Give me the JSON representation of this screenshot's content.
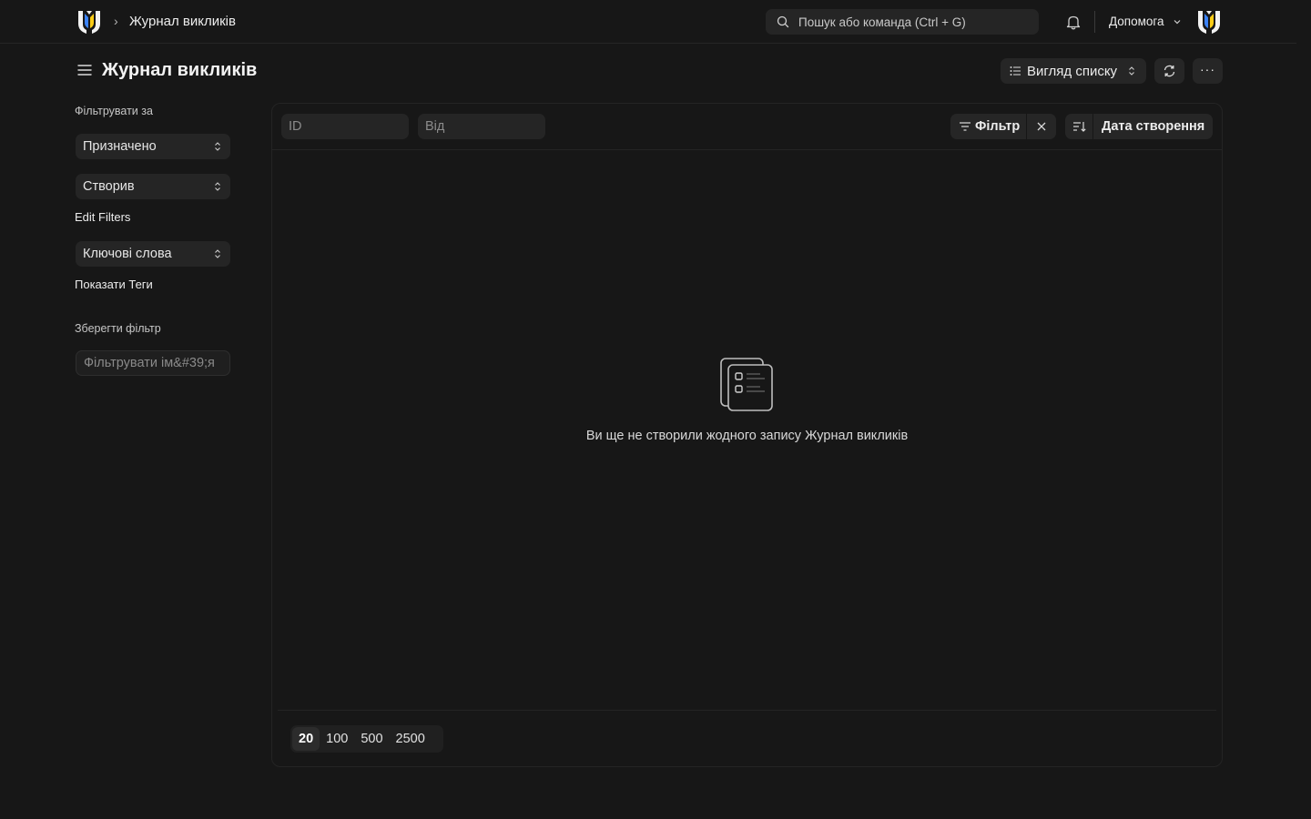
{
  "navbar": {
    "breadcrumb_separator": "›",
    "breadcrumb": "Журнал викликів",
    "search_placeholder": "Пошук або команда (Ctrl + G)",
    "help_label": "Допомога",
    "icons": [
      "app-logo-icon",
      "search-icon",
      "bell-icon",
      "chevron-down-icon",
      "avatar-logo-icon"
    ]
  },
  "page": {
    "title": "Журнал викликів",
    "view_label": "Вигляд списку",
    "more_label": "···"
  },
  "sidebar": {
    "filter_by_label": "Фільтрувати за",
    "group_by": [
      {
        "label": "Призначено"
      },
      {
        "label": "Створив"
      }
    ],
    "edit_filters_label": "Edit Filters",
    "tags_select": "Ключові слова",
    "show_tags_label": "Показати Теги",
    "save_filter_label": "Зберегти фільтр",
    "filter_name_placeholder": "Фільтрувати ім&#39;я"
  },
  "list": {
    "filters": {
      "id_placeholder": "ID",
      "from_placeholder": "Від"
    },
    "filter_button": "Фільтр",
    "sort_field": "Дата створення",
    "empty_message": "Ви ще не створили жодного запису Журнал викликів",
    "page_lengths": [
      "20",
      "100",
      "500",
      "2500"
    ],
    "selected_page_length": "20"
  },
  "colors": {
    "background": "#171717",
    "surface": "#252525",
    "text": "#ececec",
    "muted": "#8a8a8a",
    "logo_accent_blue": "#3b82f6",
    "logo_accent_yellow": "#facc15"
  }
}
